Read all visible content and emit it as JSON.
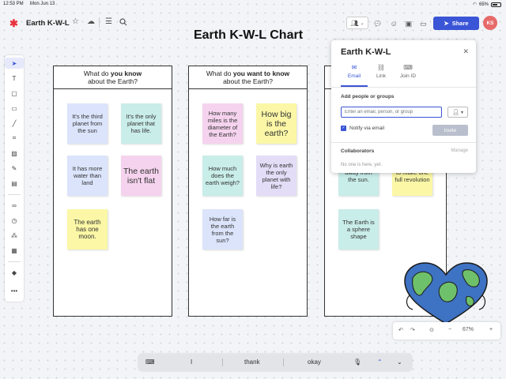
{
  "status_bar": {
    "time": "12:53 PM",
    "date": "Mon Jun 13",
    "battery": "65%"
  },
  "header": {
    "document_title": "Earth K-W-L",
    "share_label": "Share",
    "avatar_initials": "KS"
  },
  "chart_title": "Earth K-W-L Chart",
  "columns": [
    {
      "heading_pre": "What do ",
      "heading_bold": "you know",
      "heading_post": "about the Earth?",
      "notes": [
        "It's the third planet from the sun",
        "It's the only planet that has life.",
        "It has more water than land",
        "The earth isn't flat",
        "The earth has one moon."
      ]
    },
    {
      "heading_pre": "What do ",
      "heading_bold": "you want to know",
      "heading_post": "about the Earth?",
      "notes": [
        "How many miles is the diameter of the Earth?",
        "How big is the earth?",
        "How much does the earth weigh?",
        "Why is earth the only planet with life?",
        "How far is the earth from the sun?"
      ]
    },
    {
      "notes": [
        "away from the sun.",
        "to make one full revolution",
        "The Earth is a sphere shape"
      ]
    }
  ],
  "share_panel": {
    "title": "Earth K-W-L",
    "tabs": [
      "Email",
      "Link",
      "Join ID"
    ],
    "add_label": "Add people or groups",
    "email_placeholder": "Enter an email, person, or group",
    "notify_label": "Notify via email",
    "invite_label": "Invite",
    "collaborators_label": "Collaborators",
    "manage_label": "Manage",
    "empty_text": "No one is here, yet."
  },
  "zoom": {
    "level": "67%"
  },
  "keyboard": {
    "suggestions": [
      "I",
      "thank",
      "okay"
    ]
  },
  "colors": {
    "accent": "#3a55d6",
    "note_blue": "#dbe4fb",
    "note_teal": "#c9ede9",
    "note_yellow": "#fbf7a6",
    "note_pink": "#f5d3ee",
    "note_lavender": "#e3ddf7"
  }
}
